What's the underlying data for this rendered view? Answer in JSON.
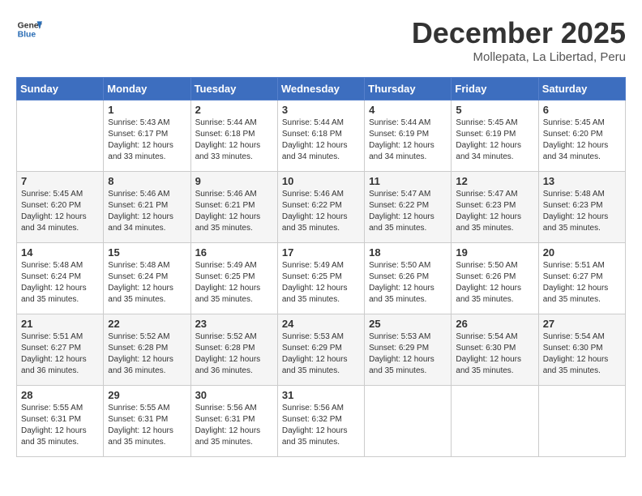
{
  "header": {
    "logo_line1": "General",
    "logo_line2": "Blue",
    "title": "December 2025",
    "location": "Mollepata, La Libertad, Peru"
  },
  "weekdays": [
    "Sunday",
    "Monday",
    "Tuesday",
    "Wednesday",
    "Thursday",
    "Friday",
    "Saturday"
  ],
  "weeks": [
    [
      {
        "day": "",
        "info": ""
      },
      {
        "day": "1",
        "info": "Sunrise: 5:43 AM\nSunset: 6:17 PM\nDaylight: 12 hours\nand 33 minutes."
      },
      {
        "day": "2",
        "info": "Sunrise: 5:44 AM\nSunset: 6:18 PM\nDaylight: 12 hours\nand 33 minutes."
      },
      {
        "day": "3",
        "info": "Sunrise: 5:44 AM\nSunset: 6:18 PM\nDaylight: 12 hours\nand 34 minutes."
      },
      {
        "day": "4",
        "info": "Sunrise: 5:44 AM\nSunset: 6:19 PM\nDaylight: 12 hours\nand 34 minutes."
      },
      {
        "day": "5",
        "info": "Sunrise: 5:45 AM\nSunset: 6:19 PM\nDaylight: 12 hours\nand 34 minutes."
      },
      {
        "day": "6",
        "info": "Sunrise: 5:45 AM\nSunset: 6:20 PM\nDaylight: 12 hours\nand 34 minutes."
      }
    ],
    [
      {
        "day": "7",
        "info": "Sunrise: 5:45 AM\nSunset: 6:20 PM\nDaylight: 12 hours\nand 34 minutes."
      },
      {
        "day": "8",
        "info": "Sunrise: 5:46 AM\nSunset: 6:21 PM\nDaylight: 12 hours\nand 34 minutes."
      },
      {
        "day": "9",
        "info": "Sunrise: 5:46 AM\nSunset: 6:21 PM\nDaylight: 12 hours\nand 35 minutes."
      },
      {
        "day": "10",
        "info": "Sunrise: 5:46 AM\nSunset: 6:22 PM\nDaylight: 12 hours\nand 35 minutes."
      },
      {
        "day": "11",
        "info": "Sunrise: 5:47 AM\nSunset: 6:22 PM\nDaylight: 12 hours\nand 35 minutes."
      },
      {
        "day": "12",
        "info": "Sunrise: 5:47 AM\nSunset: 6:23 PM\nDaylight: 12 hours\nand 35 minutes."
      },
      {
        "day": "13",
        "info": "Sunrise: 5:48 AM\nSunset: 6:23 PM\nDaylight: 12 hours\nand 35 minutes."
      }
    ],
    [
      {
        "day": "14",
        "info": "Sunrise: 5:48 AM\nSunset: 6:24 PM\nDaylight: 12 hours\nand 35 minutes."
      },
      {
        "day": "15",
        "info": "Sunrise: 5:48 AM\nSunset: 6:24 PM\nDaylight: 12 hours\nand 35 minutes."
      },
      {
        "day": "16",
        "info": "Sunrise: 5:49 AM\nSunset: 6:25 PM\nDaylight: 12 hours\nand 35 minutes."
      },
      {
        "day": "17",
        "info": "Sunrise: 5:49 AM\nSunset: 6:25 PM\nDaylight: 12 hours\nand 35 minutes."
      },
      {
        "day": "18",
        "info": "Sunrise: 5:50 AM\nSunset: 6:26 PM\nDaylight: 12 hours\nand 35 minutes."
      },
      {
        "day": "19",
        "info": "Sunrise: 5:50 AM\nSunset: 6:26 PM\nDaylight: 12 hours\nand 35 minutes."
      },
      {
        "day": "20",
        "info": "Sunrise: 5:51 AM\nSunset: 6:27 PM\nDaylight: 12 hours\nand 35 minutes."
      }
    ],
    [
      {
        "day": "21",
        "info": "Sunrise: 5:51 AM\nSunset: 6:27 PM\nDaylight: 12 hours\nand 36 minutes."
      },
      {
        "day": "22",
        "info": "Sunrise: 5:52 AM\nSunset: 6:28 PM\nDaylight: 12 hours\nand 36 minutes."
      },
      {
        "day": "23",
        "info": "Sunrise: 5:52 AM\nSunset: 6:28 PM\nDaylight: 12 hours\nand 36 minutes."
      },
      {
        "day": "24",
        "info": "Sunrise: 5:53 AM\nSunset: 6:29 PM\nDaylight: 12 hours\nand 35 minutes."
      },
      {
        "day": "25",
        "info": "Sunrise: 5:53 AM\nSunset: 6:29 PM\nDaylight: 12 hours\nand 35 minutes."
      },
      {
        "day": "26",
        "info": "Sunrise: 5:54 AM\nSunset: 6:30 PM\nDaylight: 12 hours\nand 35 minutes."
      },
      {
        "day": "27",
        "info": "Sunrise: 5:54 AM\nSunset: 6:30 PM\nDaylight: 12 hours\nand 35 minutes."
      }
    ],
    [
      {
        "day": "28",
        "info": "Sunrise: 5:55 AM\nSunset: 6:31 PM\nDaylight: 12 hours\nand 35 minutes."
      },
      {
        "day": "29",
        "info": "Sunrise: 5:55 AM\nSunset: 6:31 PM\nDaylight: 12 hours\nand 35 minutes."
      },
      {
        "day": "30",
        "info": "Sunrise: 5:56 AM\nSunset: 6:31 PM\nDaylight: 12 hours\nand 35 minutes."
      },
      {
        "day": "31",
        "info": "Sunrise: 5:56 AM\nSunset: 6:32 PM\nDaylight: 12 hours\nand 35 minutes."
      },
      {
        "day": "",
        "info": ""
      },
      {
        "day": "",
        "info": ""
      },
      {
        "day": "",
        "info": ""
      }
    ]
  ]
}
